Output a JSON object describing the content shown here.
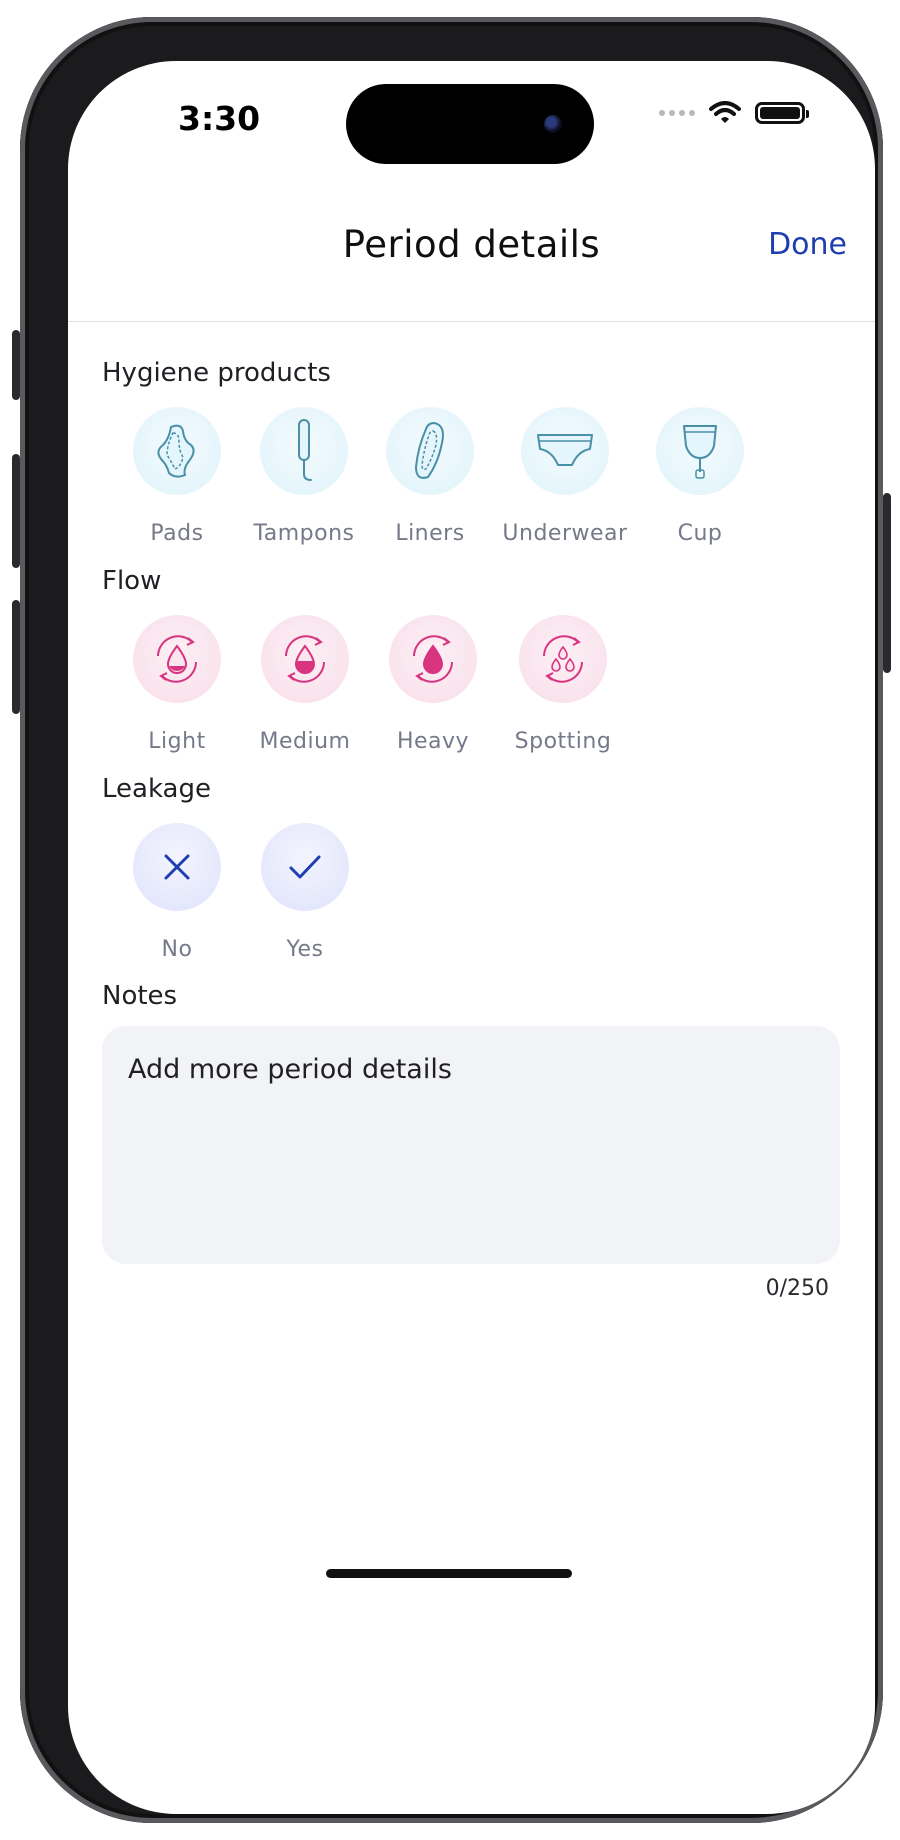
{
  "status": {
    "time": "3:30"
  },
  "header": {
    "title": "Period details",
    "done_label": "Done"
  },
  "hygiene": {
    "label": "Hygiene products",
    "items": [
      {
        "label": "Pads",
        "icon": "pad-icon"
      },
      {
        "label": "Tampons",
        "icon": "tampon-icon"
      },
      {
        "label": "Liners",
        "icon": "liner-icon"
      },
      {
        "label": "Underwear",
        "icon": "underwear-icon"
      },
      {
        "label": "Cup",
        "icon": "menstrual-cup-icon"
      }
    ]
  },
  "flow": {
    "label": "Flow",
    "items": [
      {
        "label": "Light",
        "icon": "light-flow-icon"
      },
      {
        "label": "Medium",
        "icon": "medium-flow-icon"
      },
      {
        "label": "Heavy",
        "icon": "heavy-flow-icon"
      },
      {
        "label": "Spotting",
        "icon": "spotting-icon"
      }
    ]
  },
  "leakage": {
    "label": "Leakage",
    "items": [
      {
        "label": "No",
        "icon": "close-icon"
      },
      {
        "label": "Yes",
        "icon": "check-icon"
      }
    ]
  },
  "notes": {
    "label": "Notes",
    "placeholder": "Add more period details",
    "counter": "0/250"
  },
  "colors": {
    "accent": "#1f3fb0",
    "flow_accent": "#d8347f",
    "hygiene_icon": "#4a8fa8"
  }
}
